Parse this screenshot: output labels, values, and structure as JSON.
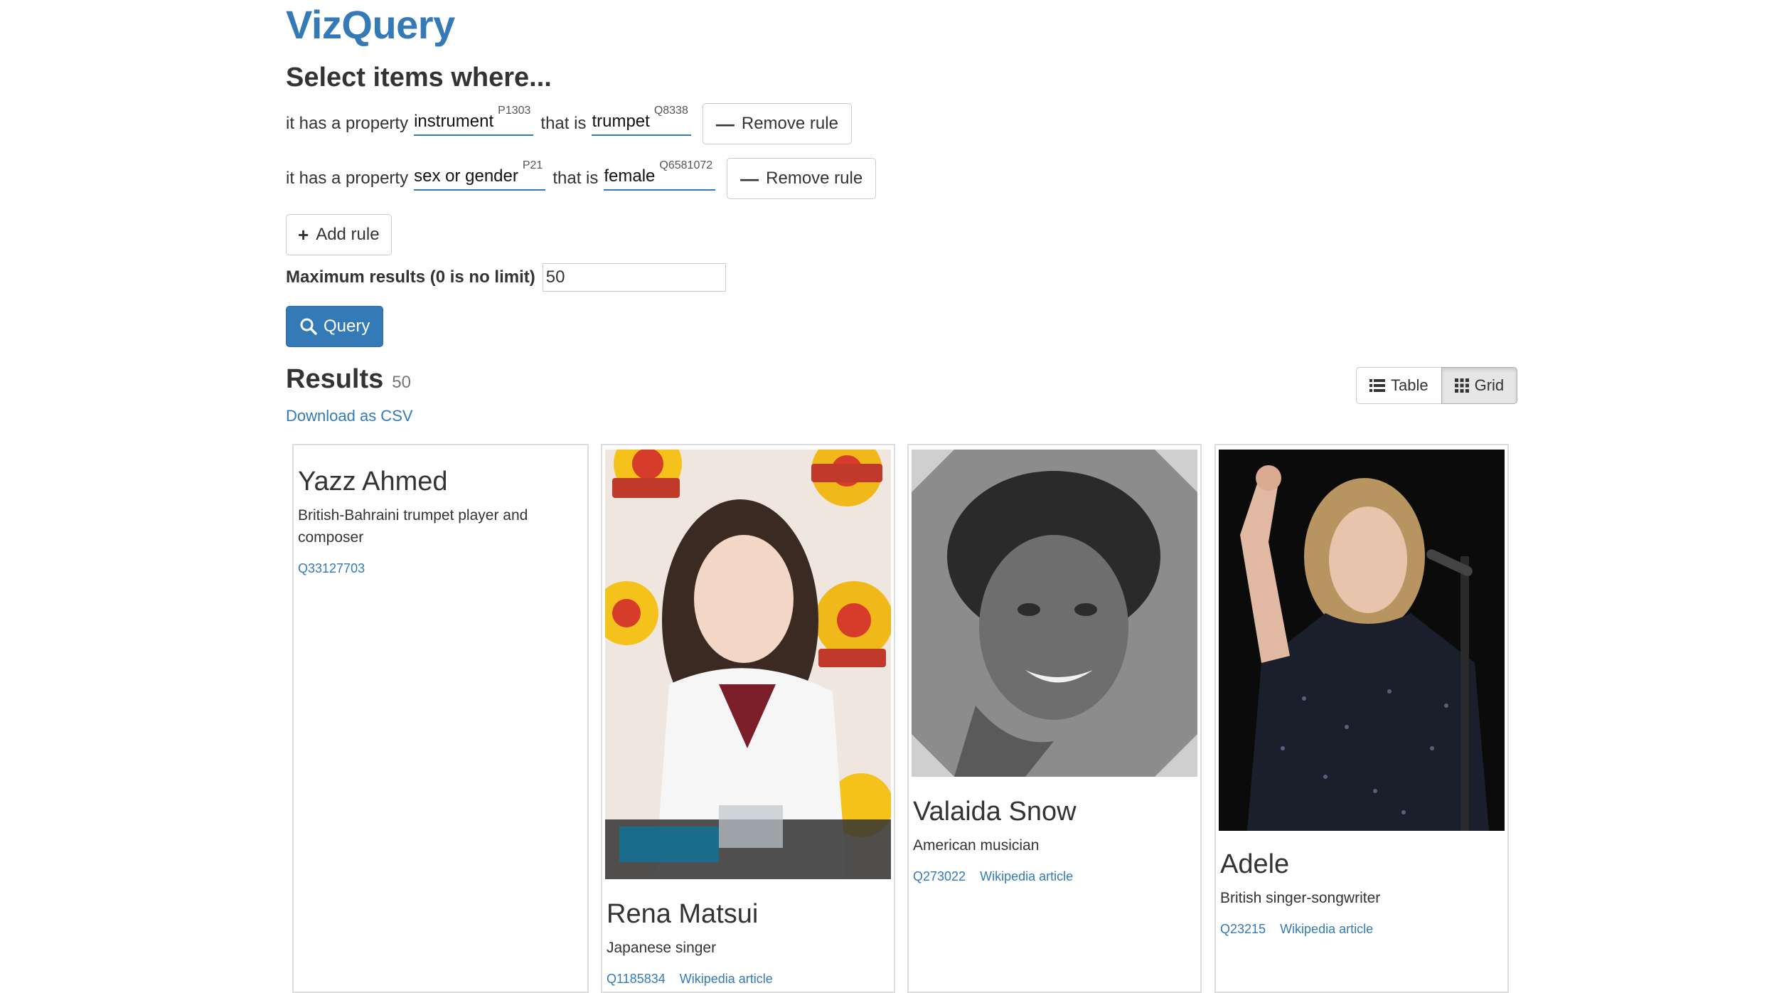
{
  "app": {
    "brand": "VizQuery"
  },
  "query": {
    "heading": "Select items where...",
    "rules": [
      {
        "prefix": "it has a property",
        "property": "instrument",
        "property_id": "P1303",
        "middle": "that is",
        "value": "trumpet",
        "value_id": "Q8338",
        "remove_label": "Remove rule"
      },
      {
        "prefix": "it has a property",
        "property": "sex or gender",
        "property_id": "P21",
        "middle": "that is",
        "value": "female",
        "value_id": "Q6581072",
        "remove_label": "Remove rule"
      }
    ],
    "add_rule_label": "Add rule",
    "max_results_label": "Maximum results (0 is no limit)",
    "max_results_value": "50",
    "query_button_label": "Query"
  },
  "results": {
    "heading": "Results",
    "count": "50",
    "download_csv": "Download as CSV",
    "view_toggle": {
      "table_label": "Table",
      "grid_label": "Grid",
      "active": "Grid"
    },
    "cards": [
      {
        "name": "Yazz Ahmed",
        "description": "British-Bahraini trumpet player and composer",
        "qid": "Q33127703",
        "wiki": "",
        "has_image": false
      },
      {
        "name": "Rena Matsui",
        "description": "Japanese singer",
        "qid": "Q1185834",
        "wiki": "Wikipedia article",
        "has_image": true
      },
      {
        "name": "Valaida Snow",
        "description": "American musician",
        "qid": "Q273022",
        "wiki": "Wikipedia article",
        "has_image": true
      },
      {
        "name": "Adele",
        "description": "British singer-songwriter",
        "qid": "Q23215",
        "wiki": "Wikipedia article",
        "has_image": true
      }
    ]
  },
  "colors": {
    "link": "#337ab7",
    "primary": "#337ab7",
    "border": "#cccccc",
    "text": "#333333"
  },
  "icons": {
    "remove": "minus-icon",
    "add": "plus-icon",
    "query": "search-icon",
    "table": "list-icon",
    "grid": "grid-icon"
  }
}
